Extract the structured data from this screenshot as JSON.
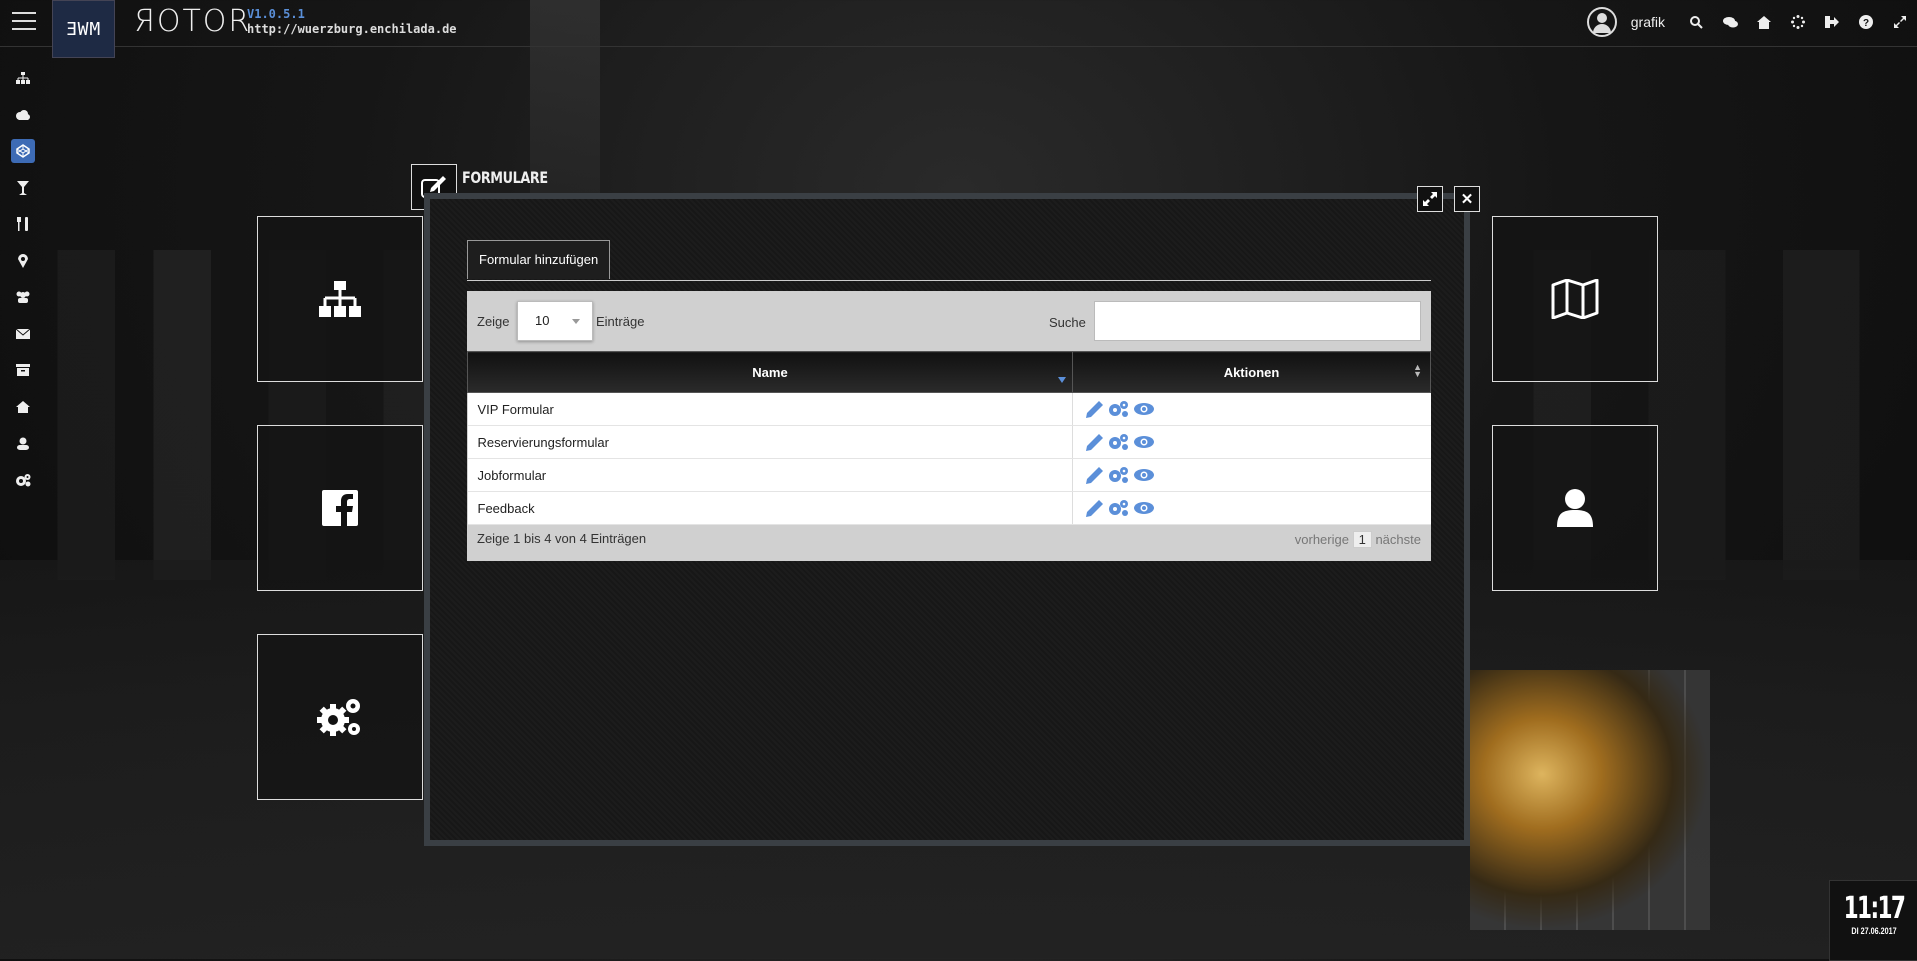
{
  "header": {
    "logo_text": "ƎWM",
    "brand": "ЯOTOR",
    "version": "V1.0.5.1",
    "url": "http://wuerzburg.enchilada.de",
    "username": "grafik",
    "icons": [
      "search-icon",
      "chat-icon",
      "home-icon",
      "spinner-icon",
      "logout-icon",
      "help-icon",
      "fullscreen-icon"
    ]
  },
  "sidebar": {
    "items": [
      "sitemap-icon",
      "cloud-icon",
      "codepen-icon",
      "cocktail-icon",
      "cutlery-icon",
      "map-marker-icon",
      "users-icon",
      "envelope-icon",
      "archive-icon",
      "home-icon",
      "user-icon",
      "cogs-icon"
    ],
    "active_index": 2
  },
  "tiles": {
    "left": [
      "sitemap-icon",
      "facebook-icon",
      "cogs-icon"
    ],
    "right": [
      "map-icon",
      "user-icon"
    ]
  },
  "modal": {
    "title": "FORMULARE",
    "tab_label": "Formular hinzufügen",
    "show_label": "Zeige",
    "page_size": "10",
    "entries_label": "Einträge",
    "search_label": "Suche",
    "search_value": "",
    "columns": [
      "Name",
      "Aktionen"
    ],
    "rows": [
      {
        "name": "VIP Formular"
      },
      {
        "name": "Reservierungsformular"
      },
      {
        "name": "Jobformular"
      },
      {
        "name": "Feedback"
      }
    ],
    "info": "Zeige 1 bis 4 von 4 Einträgen",
    "prev_label": "vorherige",
    "current_page": "1",
    "next_label": "nächste"
  },
  "clock": {
    "time": "11:17",
    "date": "DI 27.06.2017"
  },
  "colors": {
    "accent": "#3d6bb5",
    "action_icon": "#5b8fd9"
  }
}
